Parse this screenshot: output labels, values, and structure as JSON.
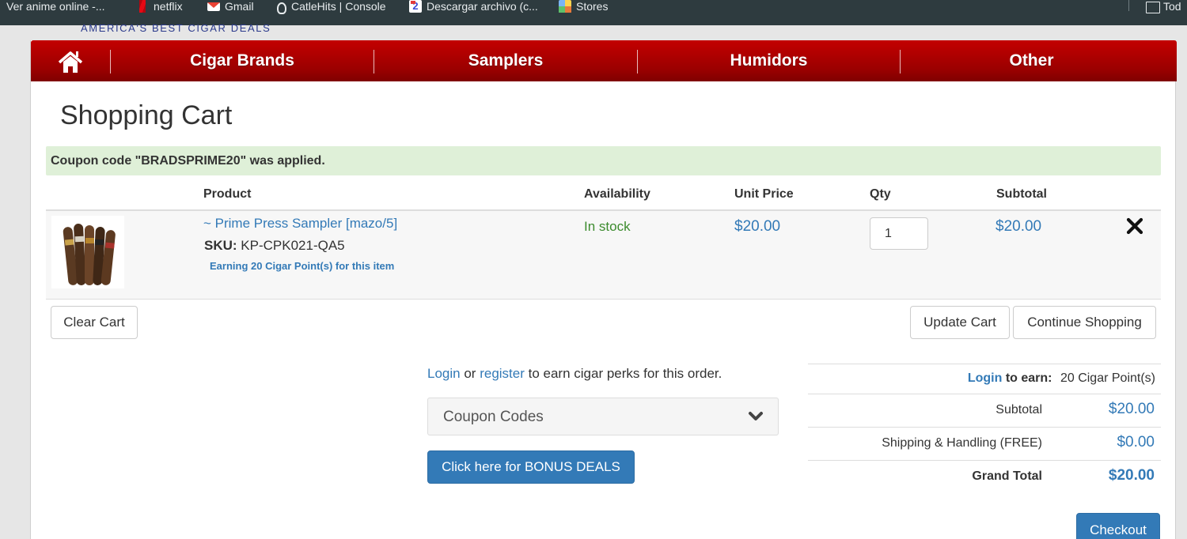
{
  "bookmarks": [
    {
      "label": "Ver anime online -...",
      "icon": "anime-icon"
    },
    {
      "label": "netflix",
      "icon": "netflix-icon"
    },
    {
      "label": "Gmail",
      "icon": "gmail-icon"
    },
    {
      "label": "CatleHits | Console",
      "icon": "catlehits-icon"
    },
    {
      "label": "Descargar archivo (c...",
      "icon": "download-site-icon"
    },
    {
      "label": "Stores",
      "icon": "stores-icon"
    },
    {
      "label": "Tod",
      "icon": "folder-icon"
    }
  ],
  "logo": {
    "tagline": "AMERICA'S BEST CIGAR DEALS"
  },
  "nav": {
    "home_icon": "home-icon",
    "items": [
      "Cigar Brands",
      "Samplers",
      "Humidors",
      "Other"
    ]
  },
  "page_title": "Shopping Cart",
  "alert": "Coupon code \"BRADSPRIME20\" was applied.",
  "cart": {
    "columns": {
      "product": "Product",
      "availability": "Availability",
      "unit_price": "Unit Price",
      "qty": "Qty",
      "subtotal": "Subtotal"
    },
    "items": [
      {
        "name": "~ Prime Press Sampler [mazo/5]",
        "sku_label": "SKU:",
        "sku": "KP-CPK021-QA5",
        "points_note": "Earning 20 Cigar Point(s) for this item",
        "availability": "In stock",
        "unit_price": "$20.00",
        "qty": "1",
        "subtotal": "$20.00"
      }
    ]
  },
  "buttons": {
    "clear_cart": "Clear Cart",
    "update_cart": "Update Cart",
    "continue_shopping": "Continue Shopping",
    "bonus_deals": "Click here for BONUS DEALS",
    "checkout": "Checkout"
  },
  "perks": {
    "login": "Login",
    "or": "or",
    "register": "register",
    "rest": "to earn cigar perks for this order."
  },
  "coupon": {
    "label": "Coupon Codes"
  },
  "totals": {
    "earn_login": "Login",
    "earn_text": "to earn:",
    "earn_value": "20 Cigar Point(s)",
    "subtotal_label": "Subtotal",
    "subtotal_value": "$20.00",
    "shipping_label": "Shipping & Handling (FREE)",
    "shipping_value": "$0.00",
    "grand_label": "Grand Total",
    "grand_value": "$20.00"
  },
  "colors": {
    "nav_red": "#b00000",
    "link_blue": "#337ab7",
    "alert_green": "#dff0d8",
    "stock_green": "#3c8b2e"
  }
}
